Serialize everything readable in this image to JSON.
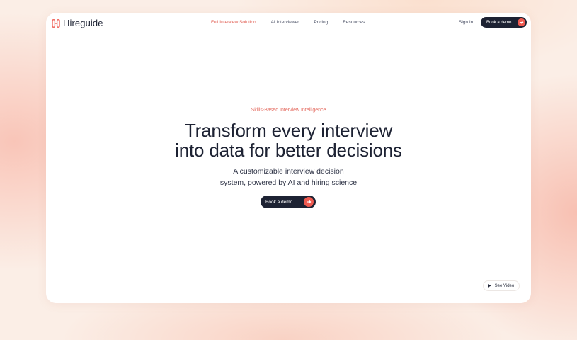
{
  "brand": {
    "name": "Hireguide",
    "accent": "#e05a4e",
    "dark": "#1d2233"
  },
  "nav": {
    "links": [
      {
        "label": "Full Interview Solution",
        "active": true
      },
      {
        "label": "AI Interviewer",
        "active": false
      },
      {
        "label": "Pricing",
        "active": false
      },
      {
        "label": "Resources",
        "active": false
      }
    ],
    "signin_label": "Sign In",
    "cta_label": "Book a demo"
  },
  "hero": {
    "eyebrow": "Skills-Based Interview Intelligence",
    "headline_line1": "Transform every interview",
    "headline_line2": "into data for better decisions",
    "sub_line1": "A customizable interview decision",
    "sub_line2": "system, powered by AI and hiring science",
    "cta_label": "Book a demo"
  },
  "video": {
    "label": "See Video",
    "icon": "play-icon"
  }
}
